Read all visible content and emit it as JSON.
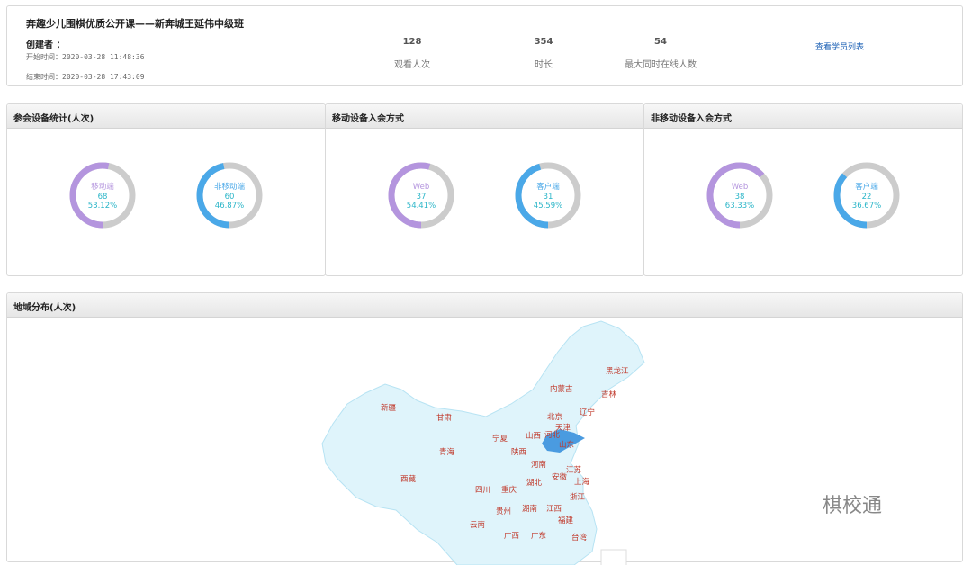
{
  "summary": {
    "title": "奔趣少儿围棋优质公开课——新奔城王延伟中级班",
    "creator": "创建者 ：",
    "start_time": "开始时间：2020-03-28 11:48:36",
    "end_time": "结束时间：2020-03-28 17:43:09",
    "stats": [
      {
        "value": "128",
        "label": "观看人次"
      },
      {
        "value": "354",
        "label": "时长"
      },
      {
        "value": "54",
        "label": "最大同时在线人数"
      }
    ],
    "student_list_link": "查看学员列表"
  },
  "panels": [
    {
      "title": "参会设备统计(人次)",
      "donuts": [
        {
          "name": "移动端",
          "count": "68",
          "percent": "53.12%",
          "fraction": 0.5312,
          "color": "#b495de"
        },
        {
          "name": "非移动端",
          "count": "60",
          "percent": "46.87%",
          "fraction": 0.4687,
          "color": "#4aa8e8"
        }
      ]
    },
    {
      "title": "移动设备入会方式",
      "donuts": [
        {
          "name": "Web",
          "count": "37",
          "percent": "54.41%",
          "fraction": 0.5441,
          "color": "#b495de"
        },
        {
          "name": "客户端",
          "count": "31",
          "percent": "45.59%",
          "fraction": 0.4559,
          "color": "#4aa8e8"
        }
      ]
    },
    {
      "title": "非移动设备入会方式",
      "donuts": [
        {
          "name": "Web",
          "count": "38",
          "percent": "63.33%",
          "fraction": 0.6333,
          "color": "#b495de"
        },
        {
          "name": "客户端",
          "count": "22",
          "percent": "36.67%",
          "fraction": 0.3667,
          "color": "#4aa8e8"
        }
      ]
    }
  ],
  "map": {
    "title": "地域分布(人次)",
    "provinces": [
      "黑龙江",
      "内蒙古",
      "吉林",
      "辽宁",
      "新疆",
      "甘肃",
      "北京",
      "天津",
      "河北",
      "山西",
      "宁夏",
      "青海",
      "陕西",
      "山东",
      "河南",
      "江苏",
      "安徽",
      "湖北",
      "上海",
      "西藏",
      "四川",
      "重庆",
      "浙江",
      "贵州",
      "湖南",
      "江西",
      "云南",
      "福建",
      "广西",
      "广东",
      "台湾"
    ],
    "highlight_province": "山东",
    "colors": {
      "base": "#dff4fb",
      "border": "#b7e3f3",
      "highlight": "#4a9be0"
    }
  },
  "watermark": "棋校通"
}
